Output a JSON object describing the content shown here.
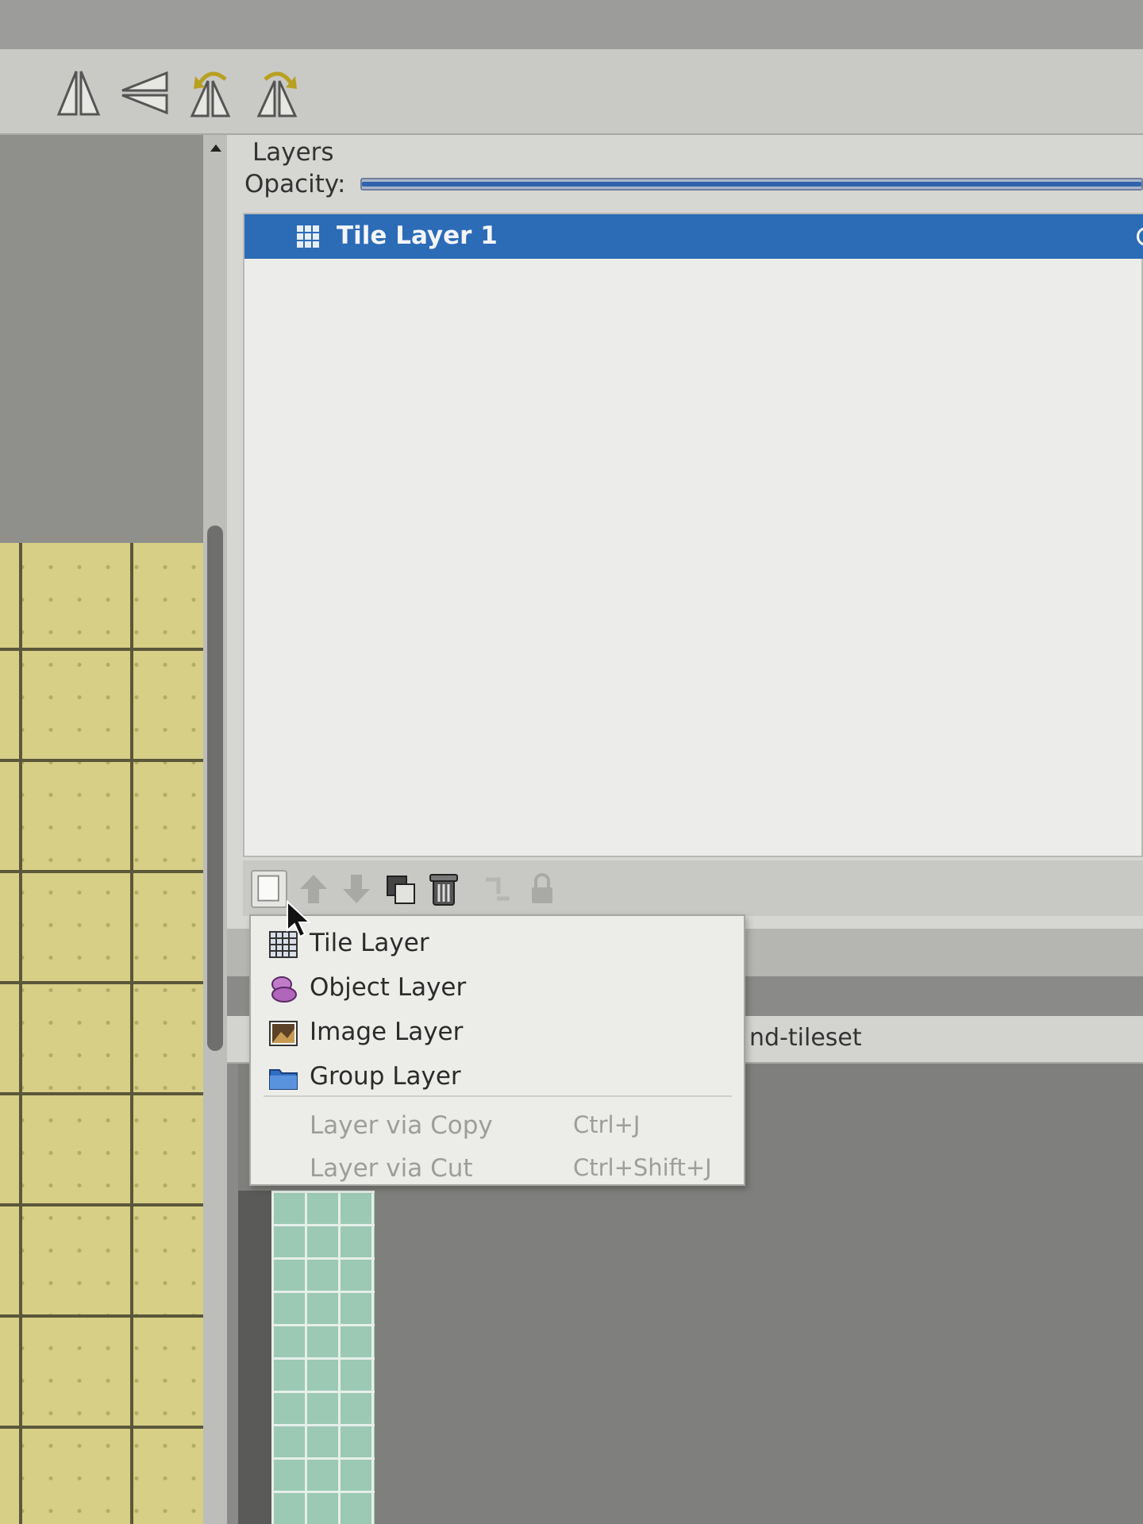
{
  "colors": {
    "selection": "#2c6bb6",
    "map_tile": "#d7cf86",
    "panel_bg": "#d6d6d3",
    "menu_bg": "#ecece9"
  },
  "toolbar": {
    "buttons": [
      {
        "name": "flip-horizontal",
        "icon": "flip-horizontal-icon"
      },
      {
        "name": "flip-vertical",
        "icon": "flip-vertical-icon"
      },
      {
        "name": "rotate-left",
        "icon": "rotate-left-icon"
      },
      {
        "name": "rotate-right",
        "icon": "rotate-right-icon"
      }
    ]
  },
  "layers_panel": {
    "title": "Layers",
    "opacity_label": "Opacity:",
    "opacity_value": 1.0,
    "layers": [
      {
        "name": "Tile Layer 1",
        "type": "tile",
        "selected": true
      }
    ],
    "tool_buttons": [
      {
        "name": "new-layer",
        "icon": "new-layer-icon"
      },
      {
        "name": "raise-layer",
        "icon": "arrow-up-icon"
      },
      {
        "name": "lower-layer",
        "icon": "arrow-down-icon"
      },
      {
        "name": "duplicate-layer",
        "icon": "duplicate-icon"
      },
      {
        "name": "remove-layer",
        "icon": "trash-icon"
      },
      {
        "name": "toggle-others",
        "icon": "toggle-visibility-icon"
      },
      {
        "name": "lock-layer",
        "icon": "lock-icon"
      }
    ]
  },
  "new_layer_menu": {
    "items": [
      {
        "label": "Tile Layer",
        "icon": "tile-layer-icon",
        "enabled": true
      },
      {
        "label": "Object Layer",
        "icon": "object-layer-icon",
        "enabled": true
      },
      {
        "label": "Image Layer",
        "icon": "image-layer-icon",
        "enabled": true
      },
      {
        "label": "Group Layer",
        "icon": "group-layer-icon",
        "enabled": true
      },
      {
        "label": "Layer via Copy",
        "shortcut": "Ctrl+J",
        "enabled": false
      },
      {
        "label": "Layer via Cut",
        "shortcut": "Ctrl+Shift+J",
        "enabled": false
      }
    ]
  },
  "tileset_panel": {
    "tab_label": "nd-tileset"
  }
}
